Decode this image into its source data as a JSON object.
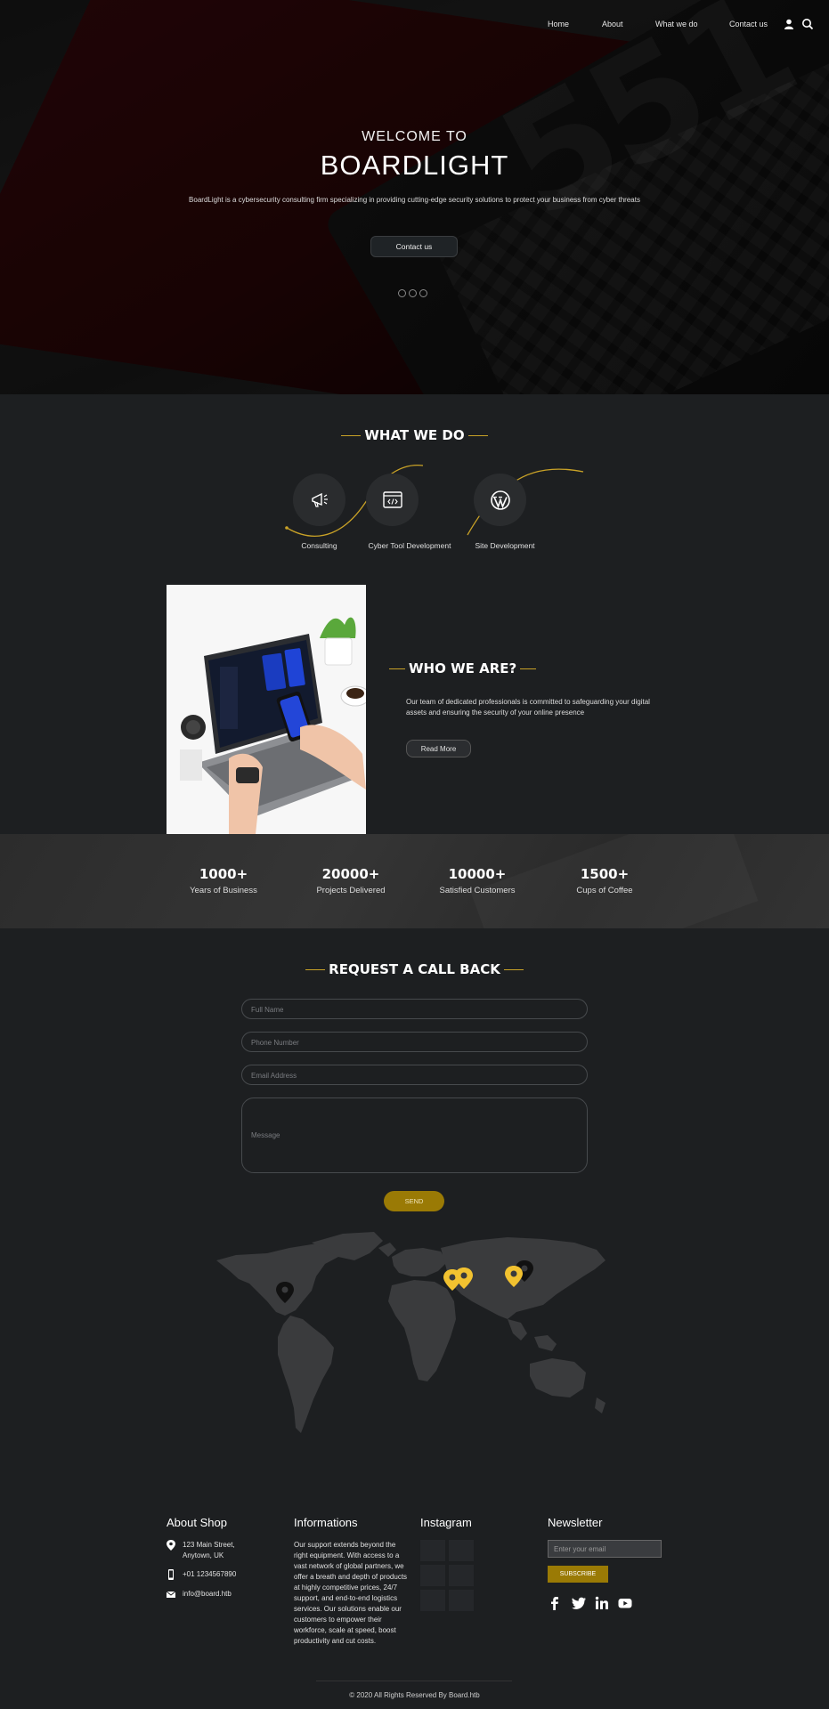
{
  "nav": {
    "items": [
      "Home",
      "About",
      "What we do",
      "Contact us"
    ],
    "user_icon": "user-icon",
    "search_icon": "search-icon"
  },
  "hero": {
    "welcome": "WELCOME TO",
    "brand": "BOARDLIGHT",
    "description": "BoardLight is a cybersecurity consulting firm specializing in providing cutting-edge security solutions to protect your business from cyber threats",
    "button": "Contact us",
    "slide_dots": 3
  },
  "what_we_do": {
    "title": "WHAT WE DO",
    "services": [
      {
        "label": "Consulting",
        "icon": "megaphone-icon"
      },
      {
        "label": "Cyber Tool Development",
        "icon": "code-window-icon"
      },
      {
        "label": "Site Development",
        "icon": "wordpress-icon"
      }
    ]
  },
  "who_we_are": {
    "title": "WHO WE ARE?",
    "description": "Our team of dedicated professionals is committed to safeguarding your digital assets and ensuring the security of your online presence",
    "button": "Read More"
  },
  "stats": [
    {
      "number": "1000+",
      "label": "Years of Business"
    },
    {
      "number": "20000+",
      "label": "Projects Delivered"
    },
    {
      "number": "10000+",
      "label": "Satisfied Customers"
    },
    {
      "number": "1500+",
      "label": "Cups of Coffee"
    }
  ],
  "callback": {
    "title": "REQUEST A CALL BACK",
    "placeholders": {
      "name": "Full Name",
      "phone": "Phone Number",
      "email": "Email Address",
      "message": "Message"
    },
    "send": "SEND"
  },
  "footer": {
    "about": {
      "title": "About Shop",
      "address": [
        "123 Main Street,",
        "Anytown, UK"
      ],
      "phone": "+01 1234567890",
      "email": "info@board.htb"
    },
    "informations": {
      "title": "Informations",
      "text": "Our support extends beyond the right equipment. With access to a vast network of global partners, we offer a breath and depth of products at highly competitive prices, 24/7 support, and end-to-end logistics services. Our solutions enable our customers to empower their workforce, scale at speed, boost productivity and cut costs."
    },
    "instagram": {
      "title": "Instagram"
    },
    "newsletter": {
      "title": "Newsletter",
      "placeholder": "Enter your email",
      "button": "SUBSCRIBE",
      "social": [
        "facebook-icon",
        "twitter-icon",
        "linkedin-icon",
        "youtube-icon"
      ]
    },
    "copyright": "© 2020 All Rights Reserved By Board.htb"
  },
  "colors": {
    "accent": "#c9a227",
    "button_gold": "#9a7a05",
    "background": "#1d1f21",
    "pin_yellow": "#f2c230"
  }
}
